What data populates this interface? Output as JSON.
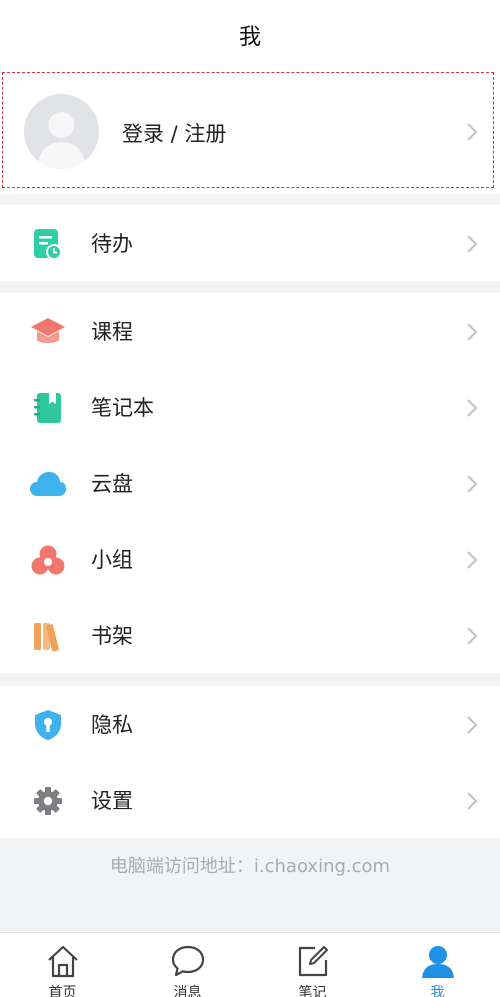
{
  "header": {
    "title": "我"
  },
  "login": {
    "label": "登录 / 注册"
  },
  "sections": {
    "todo": [
      {
        "label": "待办",
        "icon": "todo-icon"
      }
    ],
    "main": [
      {
        "label": "课程",
        "icon": "course-icon"
      },
      {
        "label": "笔记本",
        "icon": "notebook-icon"
      },
      {
        "label": "云盘",
        "icon": "cloud-icon"
      },
      {
        "label": "小组",
        "icon": "group-icon"
      },
      {
        "label": "书架",
        "icon": "bookshelf-icon"
      }
    ],
    "settings": [
      {
        "label": "隐私",
        "icon": "privacy-icon"
      },
      {
        "label": "设置",
        "icon": "settings-icon"
      }
    ]
  },
  "footer": {
    "text": "电脑端访问地址：i.chaoxing.com"
  },
  "tabbar": {
    "items": [
      {
        "label": "首页",
        "icon": "home-icon"
      },
      {
        "label": "消息",
        "icon": "message-icon"
      },
      {
        "label": "笔记",
        "icon": "note-icon"
      },
      {
        "label": "我",
        "icon": "me-icon",
        "active": true
      }
    ]
  },
  "colors": {
    "accent": "#1e90e6",
    "todo": "#2ecfa5",
    "course": "#f0776d",
    "notebook": "#2ec79e",
    "cloud": "#3db2ec",
    "group": "#f0776d",
    "bookshelf": "#f2a15a",
    "privacy": "#3db2ec",
    "settings": "#7e7f82"
  }
}
